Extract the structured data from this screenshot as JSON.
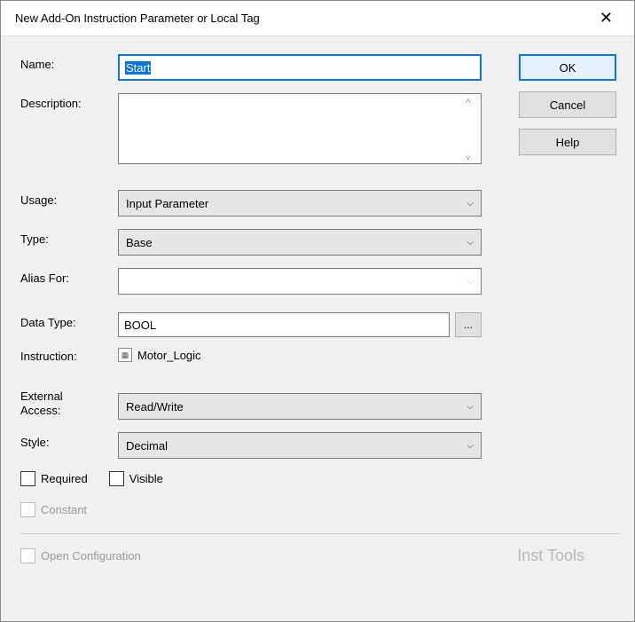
{
  "title": "New Add-On Instruction Parameter or Local Tag",
  "buttons": {
    "ok": "OK",
    "cancel": "Cancel",
    "help": "Help",
    "browse": "..."
  },
  "labels": {
    "name": "Name:",
    "description": "Description:",
    "usage": "Usage:",
    "type": "Type:",
    "alias": "Alias For:",
    "datatype": "Data Type:",
    "instruction": "Instruction:",
    "external1": "External",
    "external2": "Access:",
    "style": "Style:",
    "required": "Required",
    "visible": "Visible",
    "constant": "Constant",
    "openconfig": "Open Configuration"
  },
  "values": {
    "name": "Start",
    "usage": "Input Parameter",
    "type": "Base",
    "alias": "",
    "datatype": "BOOL",
    "instruction": "Motor_Logic",
    "external": "Read/Write",
    "style": "Decimal"
  },
  "watermark": "Inst Tools"
}
